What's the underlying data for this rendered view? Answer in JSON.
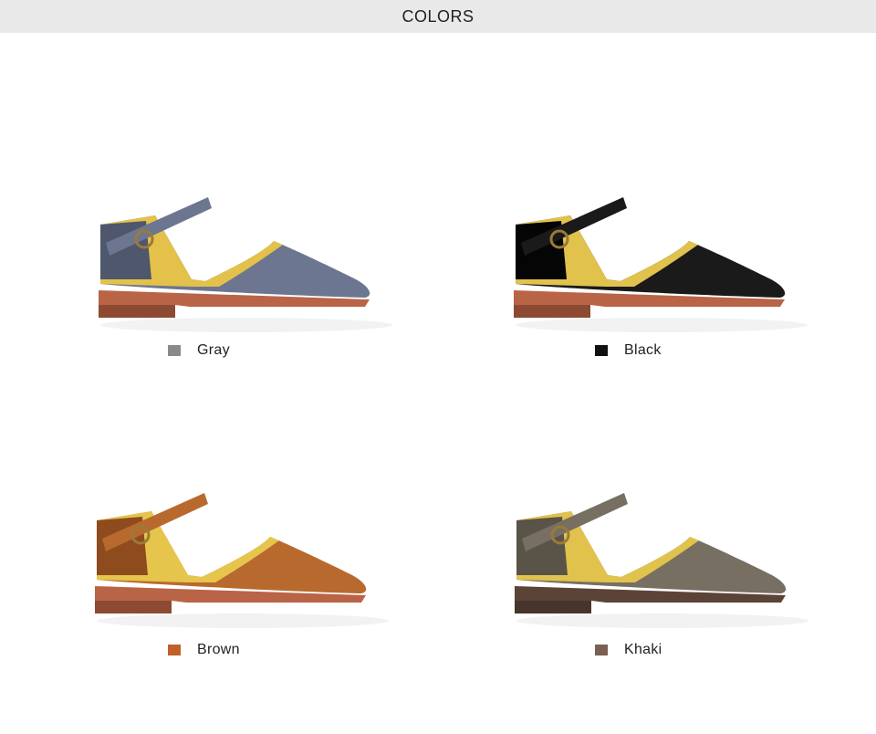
{
  "header": {
    "title": "COLORS"
  },
  "variants": [
    {
      "name": "Gray",
      "swatch": "#8a8a8a",
      "upper": "#6c7690",
      "upper_dark": "#4e576c",
      "lining": "#e3c14a"
    },
    {
      "name": "Black",
      "swatch": "#111111",
      "upper": "#1a1a1a",
      "upper_dark": "#050505",
      "lining": "#e0c24c"
    },
    {
      "name": "Brown",
      "swatch": "#c0602a",
      "upper": "#b86a2e",
      "upper_dark": "#8e4b1d",
      "lining": "#e6c54c"
    },
    {
      "name": "Khaki",
      "swatch": "#7a6050",
      "upper": "#776f62",
      "upper_dark": "#5a5347",
      "lining": "#e1c24d"
    }
  ]
}
